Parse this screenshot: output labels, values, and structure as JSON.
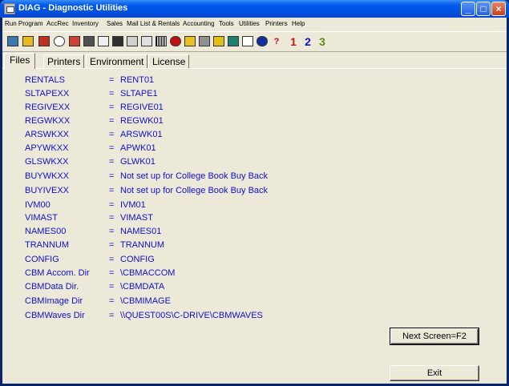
{
  "window": {
    "title": "DIAG - Diagnostic Utilities"
  },
  "menu": [
    "Run Program",
    "AccRec",
    "Inventory",
    "Sales",
    "Mail List & Rentals",
    "Accounting",
    "Tools",
    "Utilities",
    "Printers",
    "Help"
  ],
  "toolbar": {
    "icons": [
      "cash-register-icon",
      "invoice-icon",
      "printer-icon",
      "clock-icon",
      "calculator-icon",
      "phone-icon",
      "checklist-icon",
      "question-icon",
      "binoculars-icon",
      "network-icon",
      "glasses-icon",
      "barcode-icon",
      "stop-icon",
      "lock-icon",
      "cart-icon",
      "chart-icon",
      "monitor-icon",
      "to-do-icon",
      "help-circle-icon",
      "help-question-icon"
    ],
    "digits": [
      "1",
      "2",
      "3"
    ],
    "colors": {
      "d1": "#d01010",
      "d2": "#1010c8",
      "d3": "#5a8a10"
    }
  },
  "tabs": [
    "Files",
    "Printers",
    "Environment",
    "License"
  ],
  "files": [
    {
      "key": "RENTALS",
      "eq": "=",
      "value": "RENT01"
    },
    {
      "key": "SLTAPEXX",
      "eq": "=",
      "value": "SLTAPE1"
    },
    {
      "key": "REGIVEXX",
      "eq": "=",
      "value": "REGIVE01"
    },
    {
      "key": "REGWKXX",
      "eq": "=",
      "value": "REGWK01"
    },
    {
      "key": "ARSWKXX",
      "eq": "=",
      "value": "ARSWK01"
    },
    {
      "key": "APYWKXX",
      "eq": "=",
      "value": "APWK01"
    },
    {
      "key": "GLSWKXX",
      "eq": "=",
      "value": "GLWK01"
    },
    {
      "key": "BUYWKXX",
      "eq": "=",
      "value": "Not set up for College Book Buy Back"
    },
    {
      "key": "BUYIVEXX",
      "eq": "=",
      "value": "Not set up for College Book Buy Back"
    },
    {
      "key": "IVM00",
      "eq": "=",
      "value": "IVM01"
    },
    {
      "key": "VIMAST",
      "eq": "=",
      "value": "VIMAST"
    },
    {
      "key": "NAMES00",
      "eq": "=",
      "value": "NAMES01"
    },
    {
      "key": "TRANNUM",
      "eq": "=",
      "value": "TRANNUM"
    },
    {
      "key": "CONFIG",
      "eq": "=",
      "value": "CONFIG"
    },
    {
      "key": "CBM Accom. Dir",
      "eq": "=",
      "value": "\\CBMACCOM"
    },
    {
      "key": "CBMData Dir.",
      "eq": "=",
      "value": "\\CBMDATA"
    },
    {
      "key": "CBMImage Dir",
      "eq": "=",
      "value": "\\CBMIMAGE"
    },
    {
      "key": "CBMWaves Dir",
      "eq": "=",
      "value": "\\\\QUEST00S\\C-DRIVE\\CBMWAVES"
    }
  ],
  "buttons": {
    "next": "Next Screen=F2",
    "exit": "Exit"
  },
  "colors": {
    "text_blue": "#1010c8"
  }
}
